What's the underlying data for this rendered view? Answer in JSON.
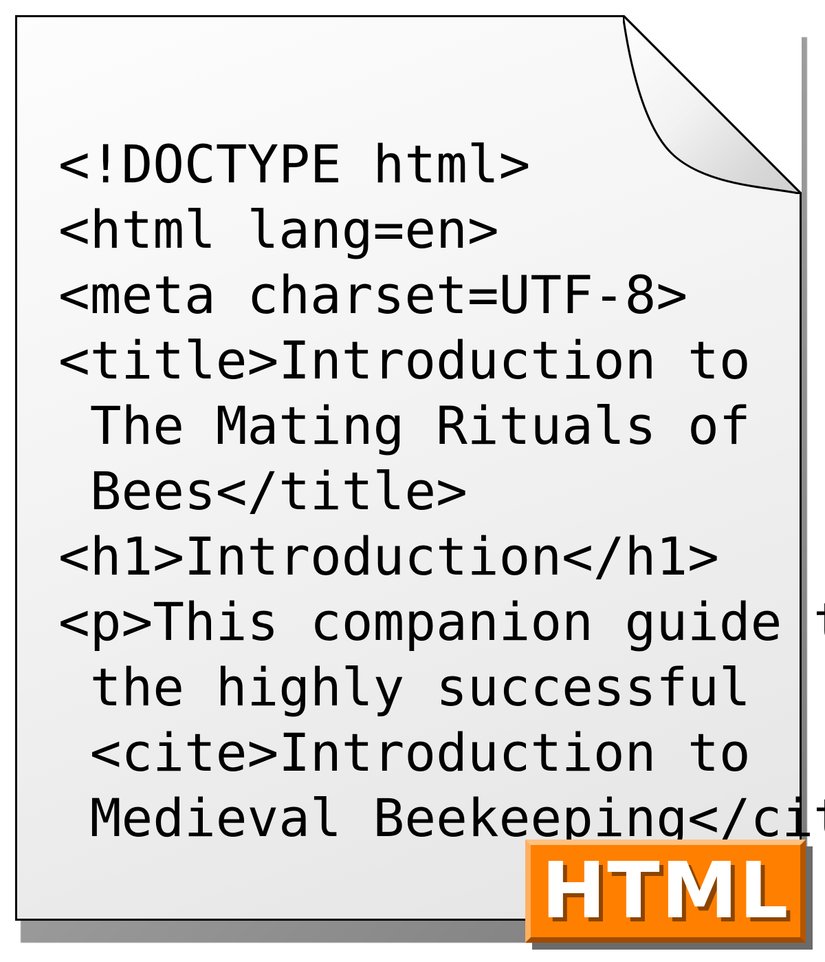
{
  "code_lines": [
    "<!DOCTYPE html>",
    "<html lang=en>",
    "<meta charset=UTF-8>",
    "<title>Introduction to",
    " The Mating Rituals of",
    " Bees</title>",
    "<h1>Introduction</h1>",
    "<p>This companion guide to",
    " the highly successful",
    " <cite>Introduction to",
    " Medieval Beekeeping</cite>…"
  ],
  "badge": {
    "label": "HTML"
  },
  "colors": {
    "badge_bg": "#ff7f00",
    "badge_text": "#ffffff",
    "page_border": "#000000"
  }
}
